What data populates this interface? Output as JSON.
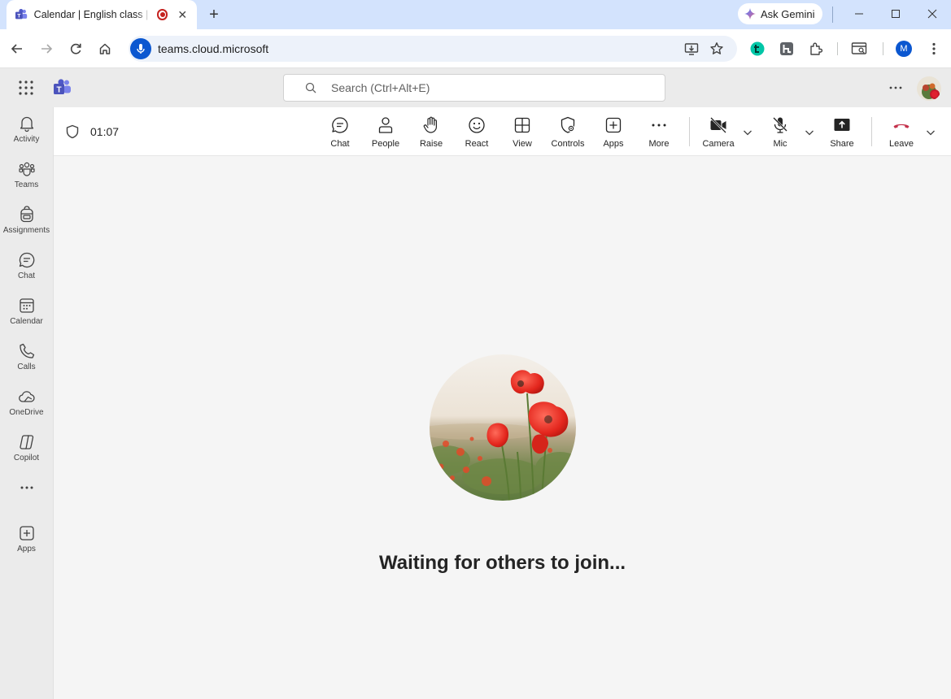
{
  "browser": {
    "tab_title": "Calendar | English class | Microsoft Teams",
    "tab_close": "✕",
    "new_tab": "+",
    "gemini_label": "Ask Gemini",
    "url": "teams.cloud.microsoft",
    "profile_initial": "M"
  },
  "teams": {
    "search_placeholder": "Search (Ctrl+Alt+E)",
    "rail": [
      {
        "label": "Activity",
        "icon": "bell-icon"
      },
      {
        "label": "Teams",
        "icon": "teams-icon"
      },
      {
        "label": "Assignments",
        "icon": "backpack-icon"
      },
      {
        "label": "Chat",
        "icon": "chat-icon"
      },
      {
        "label": "Calendar",
        "icon": "calendar-icon"
      },
      {
        "label": "Calls",
        "icon": "phone-icon"
      },
      {
        "label": "OneDrive",
        "icon": "cloud-icon"
      },
      {
        "label": "Copilot",
        "icon": "copilot-icon"
      },
      {
        "label": "Apps",
        "icon": "add-app-icon"
      }
    ]
  },
  "meeting": {
    "timer": "01:07",
    "controls": {
      "chat": "Chat",
      "people": "People",
      "raise": "Raise",
      "react": "React",
      "view": "View",
      "controls": "Controls",
      "apps": "Apps",
      "more": "More",
      "camera": "Camera",
      "mic": "Mic",
      "share": "Share",
      "leave": "Leave"
    },
    "leave_color": "#c4314b",
    "waiting_text": "Waiting for others to join..."
  }
}
